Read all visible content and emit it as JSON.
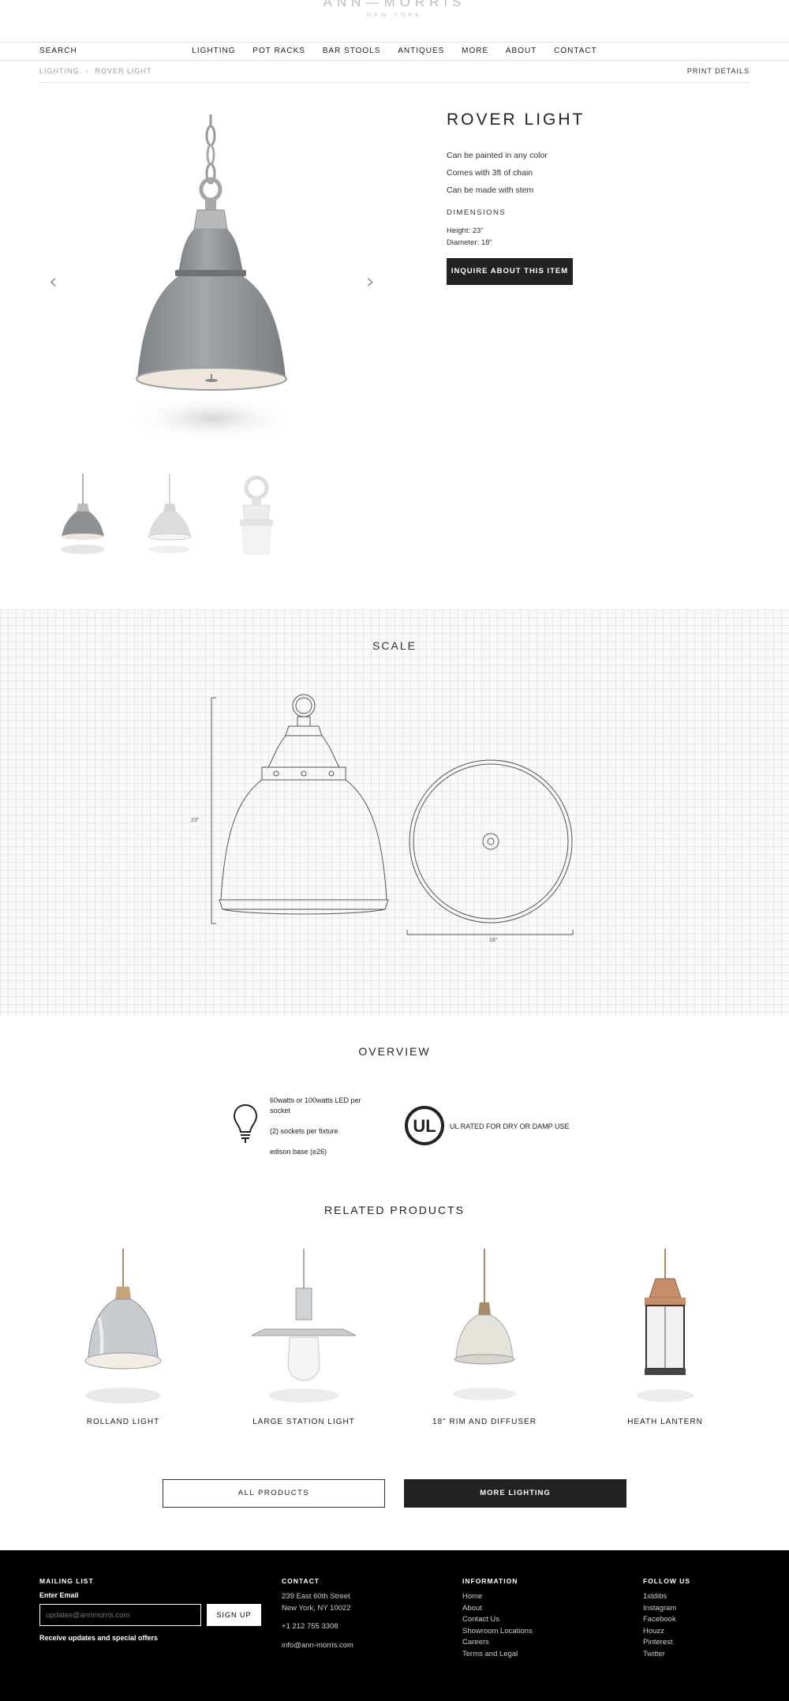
{
  "brand": {
    "name": "ANN—MORRIS",
    "city": "NEW YORK"
  },
  "nav": {
    "search": "SEARCH",
    "items": [
      "LIGHTING",
      "POT RACKS",
      "BAR STOOLS",
      "ANTIQUES",
      "MORE",
      "ABOUT",
      "CONTACT"
    ]
  },
  "breadcrumb": {
    "parent": "LIGHTING",
    "sep": "›",
    "current": "ROVER LIGHT"
  },
  "print_label": "PRINT DETAILS",
  "product": {
    "title": "ROVER LIGHT",
    "features": [
      "Can be painted in any color",
      "Comes with 3ft of chain",
      "Can be made with stem"
    ],
    "dimensions_heading": "DIMENSIONS",
    "height": "Height: 23\"",
    "diameter": "Diameter: 18\"",
    "inquire_label": "INQUIRE ABOUT THIS ITEM",
    "prev_arrow": "‹",
    "next_arrow": "›",
    "colors": {
      "shade": "#8d9193",
      "fitting": "#b9b9b9",
      "inner": "#efe7dc"
    }
  },
  "scale": {
    "title": "SCALE",
    "height_label": "23\"",
    "width_label": "18\""
  },
  "overview": {
    "title": "OVERVIEW",
    "bulb_lines": [
      "60watts or 100watts LED per socket",
      "(2) sockets per fixture",
      "edison base (e26)"
    ],
    "ul_mark": "UL",
    "ul_text": "UL RATED FOR DRY OR DAMP USE"
  },
  "related": {
    "title": "RELATED PRODUCTS",
    "items": [
      {
        "name": "ROLLAND LIGHT"
      },
      {
        "name": "LARGE STATION LIGHT"
      },
      {
        "name": "18\" RIM AND DIFFUSER"
      },
      {
        "name": "HEATH LANTERN"
      }
    ]
  },
  "buttons": {
    "all_products": "ALL PRODUCTS",
    "more_lighting": "MORE LIGHTING"
  },
  "footer": {
    "mailing_heading": "MAILING LIST",
    "email_label": "Enter Email",
    "email_placeholder": "updates@annmorris.com",
    "signup": "SIGN UP",
    "note": "Receive updates and special offers",
    "contact_heading": "CONTACT",
    "address1": "239 East 60th Street",
    "address2": "New York, NY 10022",
    "phone": "+1 212 755 3308",
    "email": "info@ann-morris.com",
    "info_heading": "INFORMATION",
    "info_links": [
      "Home",
      "About",
      "Contact Us",
      "Showroom Locations",
      "Careers",
      "Terms and Legal"
    ],
    "follow_heading": "FOLLOW US",
    "follow_links": [
      "1stdibs",
      "Instagram",
      "Facebook",
      "Houzz",
      "Pinterest",
      "Twitter"
    ]
  }
}
